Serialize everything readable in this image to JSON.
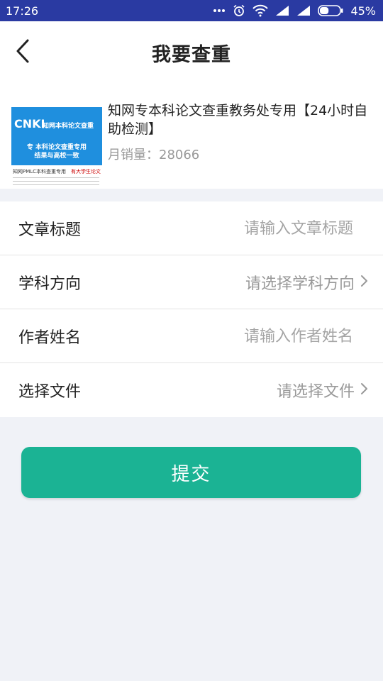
{
  "status_bar": {
    "time": "17:26",
    "battery": "45%",
    "battery_level": 0.45,
    "icons": [
      "more-dots-icon",
      "alarm-icon",
      "wifi-icon",
      "signal-icon",
      "signal-icon",
      "battery-icon"
    ]
  },
  "header": {
    "title": "我要查重",
    "back_icon": "back-arrow-icon"
  },
  "product": {
    "name": "知网专本科论文查重教务处专用【24小时自助检测】",
    "sales": "月销量：28066",
    "thumbnail": {
      "logo": "CNKI",
      "headline": "知网本科论文查重",
      "line1": "专 本科论文查重专用",
      "line2": "结果与高校一致",
      "footer_left": "知网PMLC本科查重专用",
      "footer_right": "有大学生论文"
    }
  },
  "form": {
    "title": {
      "label": "文章标题",
      "placeholder": "请输入文章标题",
      "value": ""
    },
    "subject": {
      "label": "学科方向",
      "value": "请选择学科方向",
      "icon": "chevron-right-icon"
    },
    "author": {
      "label": "作者姓名",
      "placeholder": "请输入作者姓名",
      "value": ""
    },
    "file": {
      "label": "选择文件",
      "value": "请选择文件",
      "icon": "chevron-right-icon"
    }
  },
  "submit_label": "提交",
  "colors": {
    "status_bar": "#2a3aa2",
    "accent": "#1bb394",
    "page_bg": "#f0f2f7"
  }
}
